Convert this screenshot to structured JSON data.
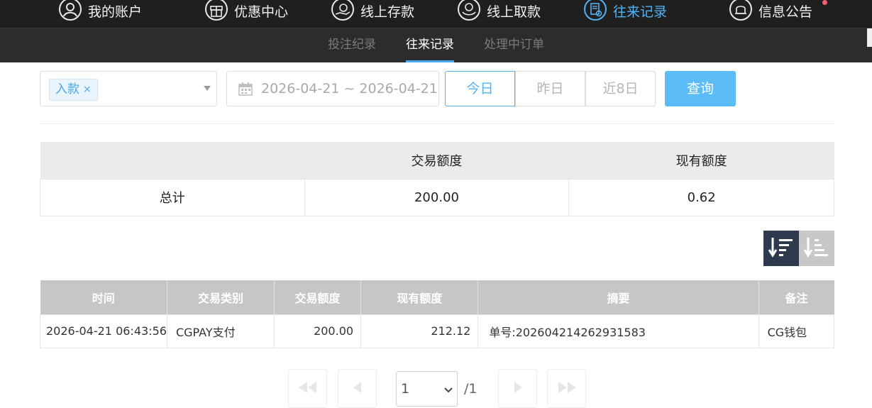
{
  "top_nav": {
    "items": [
      {
        "label": "我的账户",
        "icon": "user-icon"
      },
      {
        "label": "优惠中心",
        "icon": "gift-icon"
      },
      {
        "label": "线上存款",
        "icon": "deposit-icon"
      },
      {
        "label": "线上取款",
        "icon": "withdraw-icon"
      },
      {
        "label": "往来记录",
        "icon": "records-icon",
        "active": true
      },
      {
        "label": "信息公告",
        "icon": "bell-icon"
      }
    ],
    "accent_color": "#52b2f3",
    "notification_dot_color": "#ff5a6e"
  },
  "sub_nav": {
    "items": [
      {
        "label": "投注纪录"
      },
      {
        "label": "往来记录",
        "active": true
      },
      {
        "label": "处理中订单"
      }
    ]
  },
  "filters": {
    "type_tag": "入款",
    "tag_remove": "×",
    "date_range": "2026-04-21 ~ 2026-04-21",
    "quick_ranges": [
      "今日",
      "昨日",
      "近8日"
    ],
    "active_range": "今日",
    "query_label": "查询"
  },
  "summary": {
    "headers": [
      "",
      "交易额度",
      "现有额度"
    ],
    "row": {
      "label": "总计",
      "transaction_amount": "200.00",
      "current_balance": "0.62"
    }
  },
  "sort": {
    "options": [
      "sort-descending-icon",
      "sort-ascending-icon"
    ],
    "active": "sort-descending-icon"
  },
  "records": {
    "headers": [
      "时间",
      "交易类别",
      "交易额度",
      "现有额度",
      "摘要",
      "备注"
    ],
    "rows": [
      {
        "time": "2026-04-21 06:43:56",
        "category": "CGPAY支付",
        "amount": "200.00",
        "balance": "212.12",
        "summary": "单号:202604214262931583",
        "remark": "CG钱包"
      }
    ]
  },
  "pagination": {
    "current_page": "1",
    "total_label": "/1",
    "buttons": [
      "first-page-icon",
      "prev-page-icon",
      "next-page-icon",
      "last-page-icon"
    ]
  }
}
